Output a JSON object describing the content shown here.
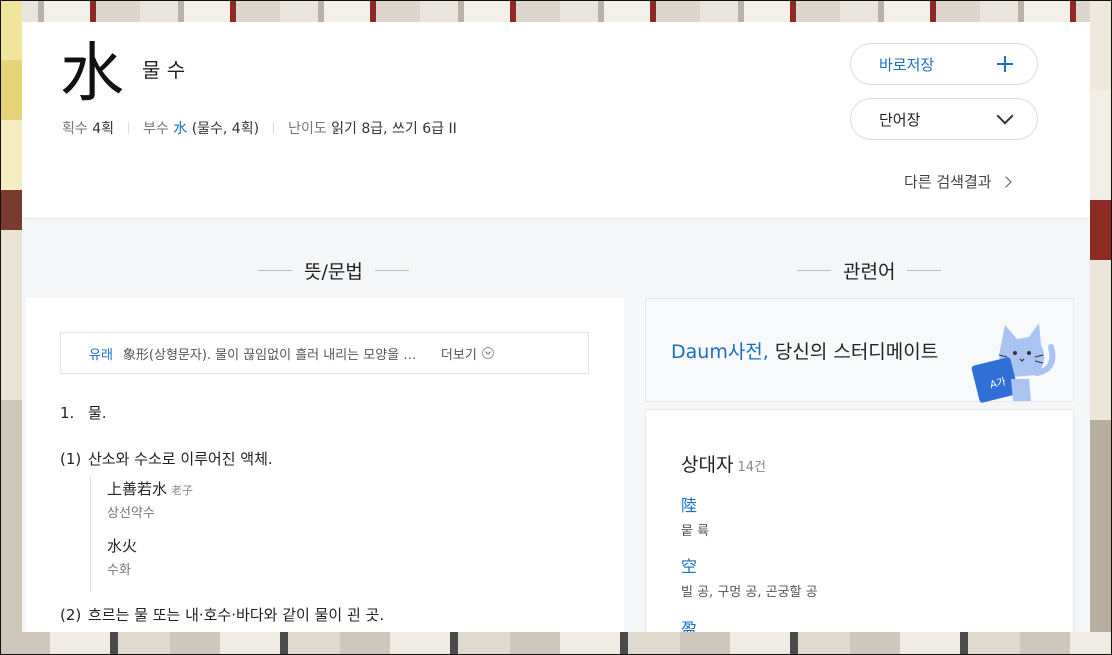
{
  "entry": {
    "hanja": "水",
    "reading": "물 수",
    "meta": {
      "strokes_label": "획수",
      "strokes_value": "4획",
      "radical_label": "부수",
      "radical_char": "水",
      "radical_detail": "(물수, 4획)",
      "level_label": "난이도",
      "level_value": "읽기 8급, 쓰기 6급 II"
    }
  },
  "actions": {
    "save_label": "바로저장",
    "vocab_label": "단어장",
    "other_results": "다른 검색결과"
  },
  "sections": {
    "meaning_title": "뜻/문법",
    "related_title": "관련어"
  },
  "origin": {
    "label": "유래",
    "text": "象形(상형문자). 물이 끊임없이 흘러 내리는 모양을 본뜸.…",
    "more": "더보기"
  },
  "meanings": {
    "main_num": "1.",
    "main_text": "물.",
    "sub1_num": "(1)",
    "sub1_text": "산소와 수소로 이루어진 액체.",
    "examples": [
      {
        "hanja": "上善若水",
        "source": "老子",
        "reading": "상선약수"
      },
      {
        "hanja": "水火",
        "source": "",
        "reading": "수화"
      }
    ],
    "sub2_num": "(2)",
    "sub2_text": "흐르는 물 또는 내·호수·바다와 같이 물이 괸 곳."
  },
  "banner": {
    "brand": "Daum사전,",
    "text": " 당신의 스터디메이트",
    "book_text": "A가"
  },
  "related": {
    "title": "상대자",
    "count": "14건",
    "items": [
      {
        "char": "陸",
        "meaning": "뭍 륙"
      },
      {
        "char": "空",
        "meaning": "빌 공, 구멍 공, 곤궁할 공"
      },
      {
        "char": "盈",
        "meaning": ""
      }
    ]
  },
  "colors": {
    "accent": "#1a6ec8",
    "card_bg": "#f5f6f7"
  }
}
